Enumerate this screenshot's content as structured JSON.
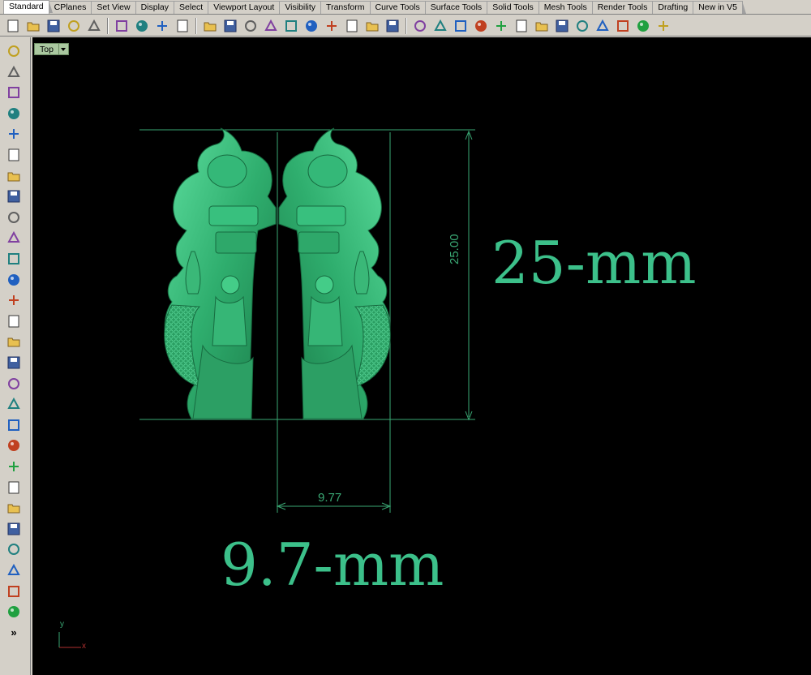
{
  "tabs": [
    {
      "label": "Standard",
      "active": true
    },
    {
      "label": "CPlanes",
      "active": false
    },
    {
      "label": "Set View",
      "active": false
    },
    {
      "label": "Display",
      "active": false
    },
    {
      "label": "Select",
      "active": false
    },
    {
      "label": "Viewport Layout",
      "active": false
    },
    {
      "label": "Visibility",
      "active": false
    },
    {
      "label": "Transform",
      "active": false
    },
    {
      "label": "Curve Tools",
      "active": false
    },
    {
      "label": "Surface Tools",
      "active": false
    },
    {
      "label": "Solid Tools",
      "active": false
    },
    {
      "label": "Mesh Tools",
      "active": false
    },
    {
      "label": "Render Tools",
      "active": false
    },
    {
      "label": "Drafting",
      "active": false
    },
    {
      "label": "New in V5",
      "active": false
    }
  ],
  "toolbar_icons": [
    "new-file-icon",
    "open-folder-icon",
    "save-icon",
    "print-icon",
    "import-icon",
    "cut-icon",
    "copy-icon",
    "paste-icon",
    "undo-icon",
    "pan-hand-icon",
    "rotate-view-icon",
    "zoom-icon",
    "zoom-window-icon",
    "zoom-extents-icon",
    "zoom-selected-icon",
    "undo-view-icon",
    "four-viewports-icon",
    "car-icon",
    "rotate-icon",
    "grid-icon",
    "select-icon",
    "light-icon",
    "lock-icon",
    "render-material-icon",
    "color-wheel-icon",
    "shaded-sphere-icon",
    "rendered-sphere-icon",
    "blue-sphere-icon",
    "flag-icon",
    "gears-icon",
    "options-icon",
    "help-icon"
  ],
  "left_toolbar_icons": [
    "select-arrow-icon",
    "point-icon",
    "polyline-icon",
    "curve-icon",
    "circle-icon",
    "ellipse-icon",
    "arc-icon",
    "rectangle-icon",
    "polygon-icon",
    "freeform-icon",
    "surface-icon",
    "extrude-icon",
    "box-icon",
    "boolean-icon",
    "pipe-icon",
    "mesh-icon",
    "gear-icon",
    "explode-icon",
    "trim-icon",
    "split-icon",
    "group-icon",
    "join-icon",
    "fillet-icon",
    "text-icon",
    "dimension-icon",
    "array-icon",
    "transform-icon",
    "solid-icon",
    "more-icon"
  ],
  "viewport": {
    "name": "Top",
    "axis_y": "y",
    "axis_x": "x"
  },
  "dimensions": {
    "vertical_value": "25.00",
    "horizontal_value": "9.77",
    "height_label": "25-mm",
    "width_label": "9.7-mm"
  },
  "colors": {
    "model_green": "#3cc08a",
    "dimension_green": "#3aa874",
    "viewport_bg": "#000000",
    "chrome": "#d4d0c8"
  }
}
